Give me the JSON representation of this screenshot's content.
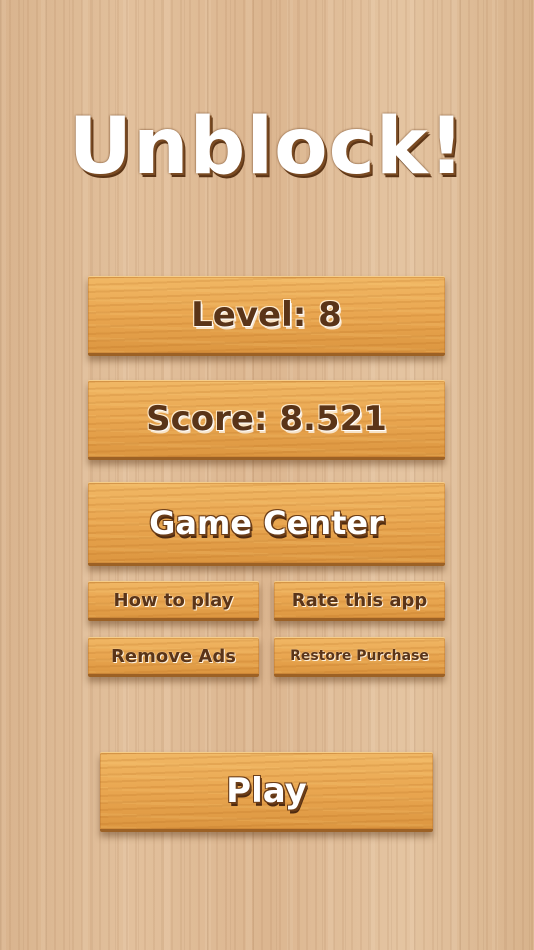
{
  "title": "Unblock!",
  "stats": {
    "level": "Level: 8",
    "score": "Score: 8.521"
  },
  "menu": {
    "game_center": "Game Center",
    "how_to_play": "How to play",
    "rate_app": "Rate this app",
    "remove_ads": "Remove Ads",
    "restore_purchase": "Restore Purchase",
    "play": "Play"
  },
  "colors": {
    "background_wood": "#dfbb95",
    "plank_wood": "#e9a650",
    "text_dark_brown": "#5a3418",
    "text_white": "#ffffff"
  }
}
